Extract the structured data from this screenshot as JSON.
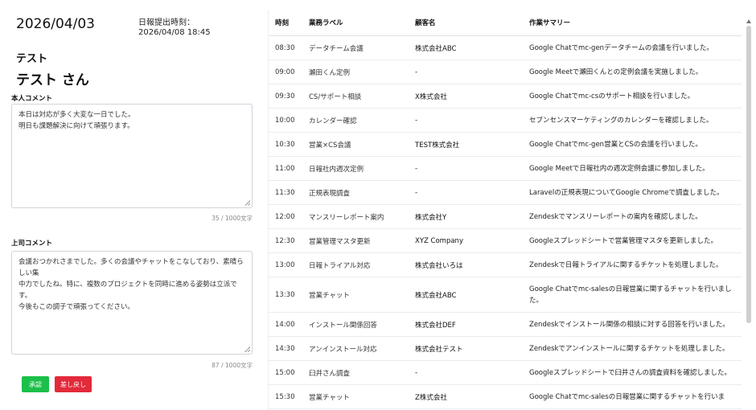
{
  "report": {
    "date": "2026/04/03",
    "submit_label": "日報提出時刻：",
    "submit_time": "2026/04/08 18:45",
    "department": "テスト",
    "person": "テスト さん"
  },
  "self_comment": {
    "label": "本人コメント",
    "lines": [
      "本日は対応が多く大変な一日でした。",
      "明日も課題解決に向けて頑張ります。"
    ],
    "count": "35 / 1000文字"
  },
  "boss_comment": {
    "label": "上司コメント",
    "lines": [
      "会議おつかれさまでした。多くの会議やチャットをこなしており、素晴らしい集",
      "中力でしたね。特に、複数のプロジェクトを同時に進める姿勢は立派です。",
      "今後もこの調子で頑張ってください。"
    ],
    "count": "87 / 1000文字"
  },
  "buttons": {
    "approve": "承認",
    "return": "差し戻し"
  },
  "table": {
    "headers": {
      "time": "時刻",
      "label": "業務ラベル",
      "customer": "顧客名",
      "summary": "作業サマリー"
    },
    "rows": [
      {
        "time": "08:30",
        "label": "データチーム会議",
        "customer": "株式会社ABC",
        "summary": "Google Chatでmc-genデータチームの会議を行いました。"
      },
      {
        "time": "09:00",
        "label": "瀬田くん定例",
        "customer": "-",
        "summary": "Google Meetで瀬田くんとの定例会議を実施しました。"
      },
      {
        "time": "09:30",
        "label": "CS/サポート相談",
        "customer": "X株式会社",
        "summary": "Google Chatでmc-csのサポート相談を行いました。"
      },
      {
        "time": "10:00",
        "label": "カレンダー確認",
        "customer": "-",
        "summary": "セブンセンスマーケティングのカレンダーを確認しました。"
      },
      {
        "time": "10:30",
        "label": "営業×CS会議",
        "customer": "TEST株式会社",
        "summary": "Google Chatでmc-gen営業とCSの会議を行いました。"
      },
      {
        "time": "11:00",
        "label": "日報社内週次定例",
        "customer": "-",
        "summary": "Google Meetで日報社内の週次定例会議に参加しました。"
      },
      {
        "time": "11:30",
        "label": "正規表現調査",
        "customer": "-",
        "summary": "Laravelの正規表現についてGoogle Chromeで調査しました。"
      },
      {
        "time": "12:00",
        "label": "マンスリーレポート案内",
        "customer": "株式会社Y",
        "summary": "Zendeskでマンスリーレポートの案内を確認しました。"
      },
      {
        "time": "12:30",
        "label": "営業管理マスタ更新",
        "customer": "XYZ Company",
        "summary": "Googleスプレッドシートで営業管理マスタを更新しました。"
      },
      {
        "time": "13:00",
        "label": "日報トライアル対応",
        "customer": "株式会社いろは",
        "summary": "Zendeskで日報トライアルに関するチケットを処理しました。"
      },
      {
        "time": "13:30",
        "label": "営業チャット",
        "customer": "株式会社ABC",
        "summary": "Google Chatでmc-salesの日報営業に関するチャットを行いました。"
      },
      {
        "time": "14:00",
        "label": "インストール関係回答",
        "customer": "株式会社DEF",
        "summary": "Zendeskでインストール関係の相談に対する回答を行いました。"
      },
      {
        "time": "14:30",
        "label": "アンインストール対応",
        "customer": "株式会社テスト",
        "summary": "Zendeskでアンインストールに関するチケットを処理しました。"
      },
      {
        "time": "15:00",
        "label": "臼井さん調査",
        "customer": "-",
        "summary": "Googleスプレッドシートで臼井さんの調査資料を確認しました。"
      },
      {
        "time": "15:30",
        "label": "営業チャット",
        "customer": "Z株式会社",
        "summary": "Google Chatでmc-salesの日報営業に関するチャットを行いま"
      }
    ]
  }
}
